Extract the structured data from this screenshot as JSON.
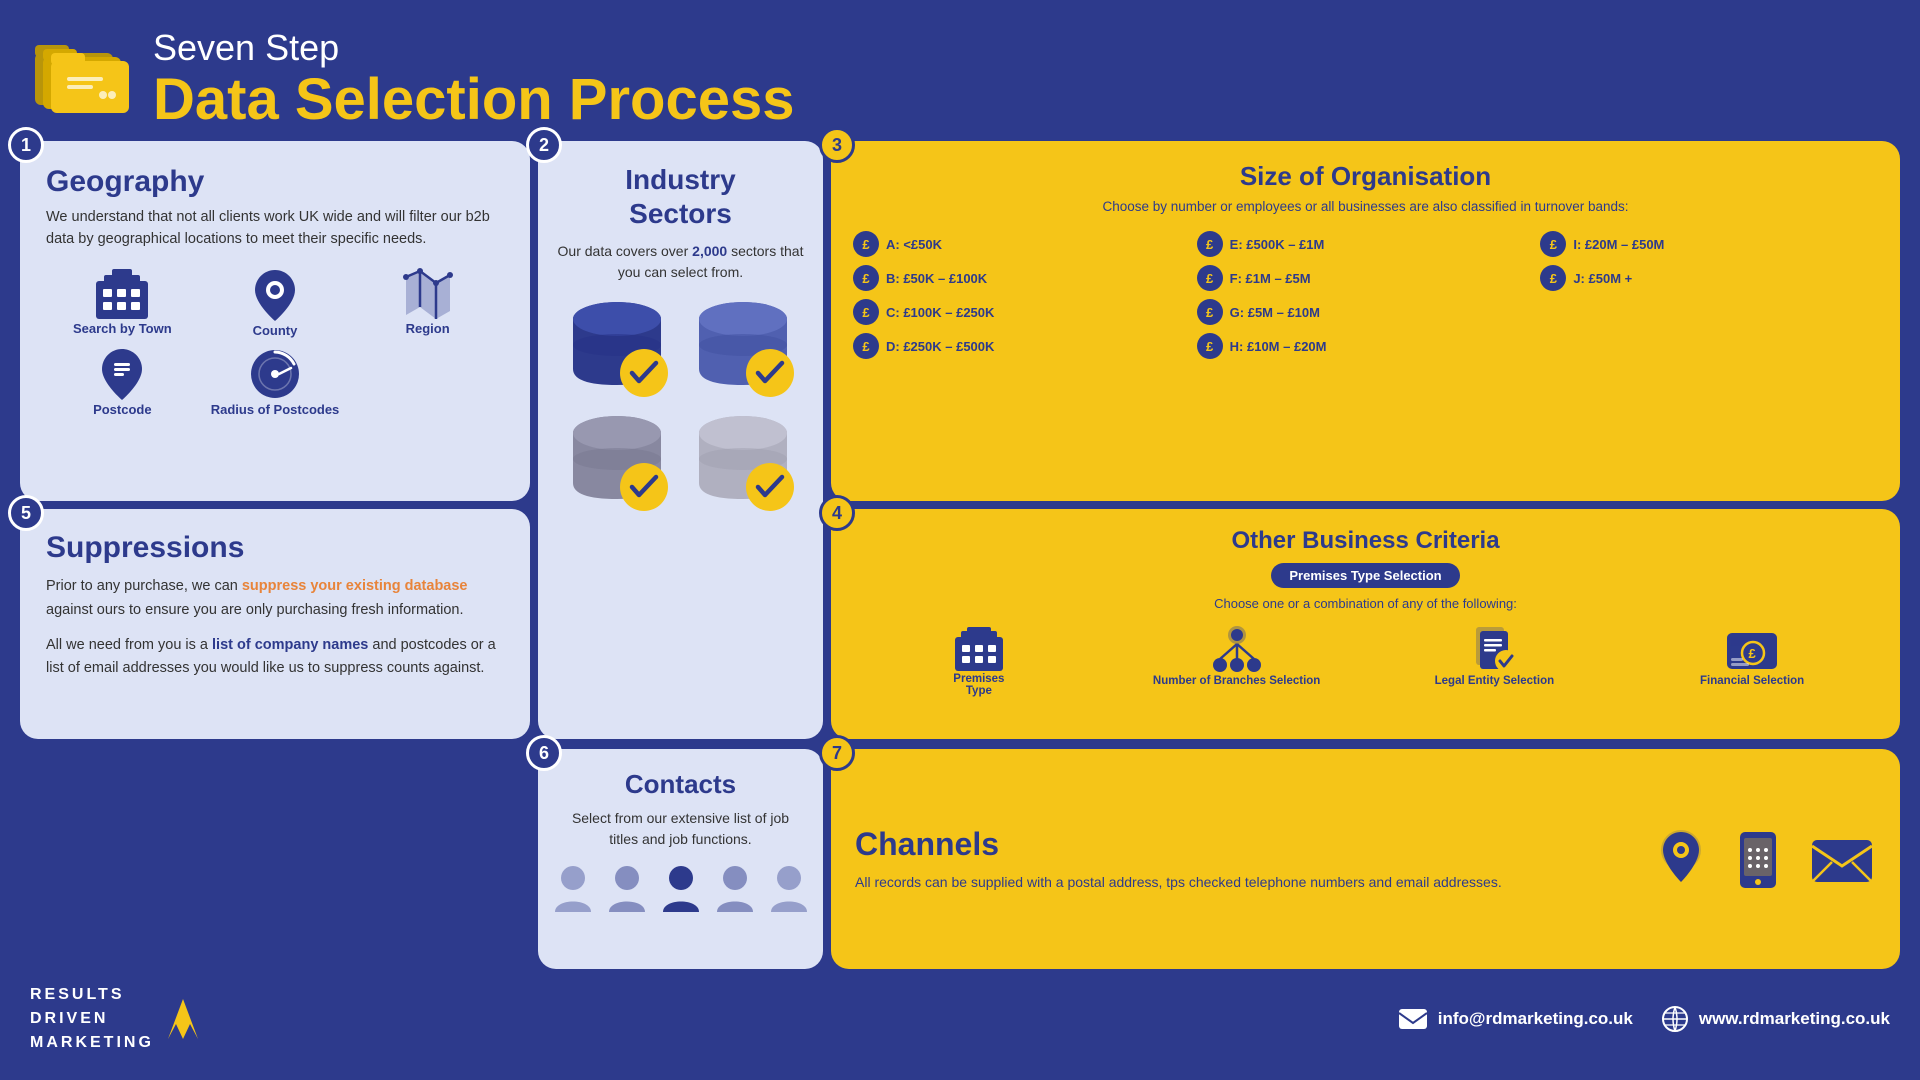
{
  "header": {
    "subtitle": "Seven Step",
    "title": "Data Selection Process",
    "icon_alt": "folder-icon"
  },
  "steps": {
    "s1": {
      "number": "1",
      "title": "Geography",
      "description": "We understand that not all clients work UK wide and will filter our b2b data by geographical locations to meet their specific needs.",
      "geo_items": [
        {
          "label": "Search by Town",
          "icon": "building"
        },
        {
          "label": "County",
          "icon": "map-pin"
        },
        {
          "label": "Region",
          "icon": "region"
        },
        {
          "label": "Postcode",
          "icon": "postcode"
        },
        {
          "label": "Radius of Postcodes",
          "icon": "radius"
        }
      ]
    },
    "s2": {
      "number": "2",
      "title": "Industry Sectors",
      "description": "Our data covers over 2,000 sectors that you can select from.",
      "highlight": "2,000"
    },
    "s3": {
      "number": "3",
      "title": "Size of Organisation",
      "subtitle": "Choose by number or employees or all businesses are also classified in turnover bands:",
      "bands": [
        {
          "label": "A: <£50K"
        },
        {
          "label": "E: £500K – £1M"
        },
        {
          "label": "I: £20M – £50M"
        },
        {
          "label": "B: £50K – £100K"
        },
        {
          "label": "F: £1M – £5M"
        },
        {
          "label": "J: £50M +"
        },
        {
          "label": "C: £100K – £250K"
        },
        {
          "label": "G: £5M – £10M"
        },
        {
          "label": ""
        },
        {
          "label": "D: £250K – £500K"
        },
        {
          "label": "H: £10M – £20M"
        },
        {
          "label": ""
        }
      ]
    },
    "s4": {
      "number": "4",
      "title": "Other Business Criteria",
      "badge": "Premises Type Selection",
      "subtitle": "Choose one or a combination of any of the following:",
      "criteria": [
        {
          "label": "Premises Type"
        },
        {
          "label": "Number of Branches Selection"
        },
        {
          "label": "Legal Entity Selection"
        },
        {
          "label": "Financial Selection"
        }
      ]
    },
    "s5": {
      "number": "5",
      "title": "Suppressions",
      "para1": "Prior to any purchase, we can suppress your existing database against ours to ensure you are only purchasing fresh information.",
      "para1_highlight": "suppress your existing database",
      "para2_prefix": "All we need from you is a ",
      "para2_link": "list of company names",
      "para2_suffix": " and postcodes or a list of email addresses you would like us to suppress counts against."
    },
    "s6": {
      "number": "6",
      "title": "Contacts",
      "description": "Select from our extensive list of job titles and job functions."
    },
    "s7": {
      "number": "7",
      "title": "Channels",
      "description": "All records can be supplied with a postal address, tps checked telephone numbers and email addresses."
    }
  },
  "footer": {
    "brand_line1": "RESULTS",
    "brand_line2": "DRIVEN",
    "brand_line3": "MARKETING",
    "email": "info@rdmarketing.co.uk",
    "website": "www.rdmarketing.co.uk"
  }
}
